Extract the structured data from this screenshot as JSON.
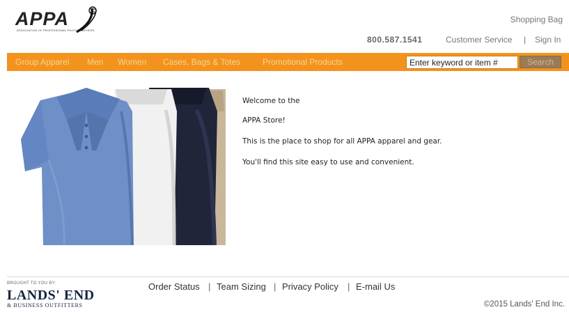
{
  "header": {
    "logo_text": "APPA",
    "logo_tagline": "ASSOCIATION OF PROFESSIONAL PHOTOGRAPHERS",
    "shopping_bag": "Shopping Bag",
    "phone": "800.587.1541",
    "customer_service": "Customer Service",
    "separator": "|",
    "sign_in": "Sign In"
  },
  "nav": {
    "items": [
      {
        "label": "Group Apparel"
      },
      {
        "label": "Men"
      },
      {
        "label": "Women"
      },
      {
        "label": "Cases, Bags & Totes"
      },
      {
        "label": "Promotional Products"
      }
    ],
    "search_placeholder": "Enter keyword or item #",
    "search_button": "Search",
    "bar_color": "#f3931e"
  },
  "main": {
    "image_alt_icon": "polo-shirts-image",
    "welcome_lines": [
      "Welcome to the",
      "APPA Store!",
      "This is the place to shop for all APPA apparel and gear.",
      "You'll find this site easy to use and convenient."
    ]
  },
  "footer": {
    "brought_by": "BROUGHT TO YOU BY:",
    "brand": "LANDS' END",
    "brand_sub": "& BUSINESS OUTFITTERS",
    "links": [
      {
        "label": "Order Status"
      },
      {
        "label": "Team Sizing"
      },
      {
        "label": "Privacy Policy"
      },
      {
        "label": "E-mail Us"
      }
    ],
    "link_separator": "|",
    "copyright": "©2015 Lands' End Inc."
  }
}
